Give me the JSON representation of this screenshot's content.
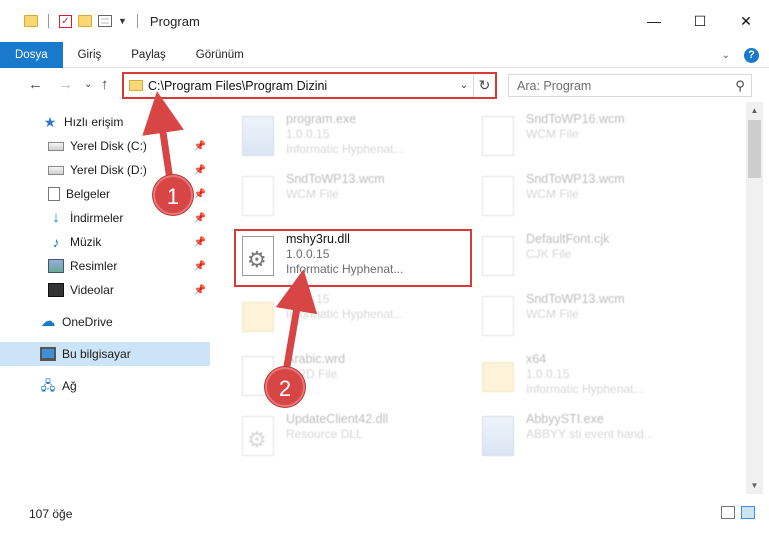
{
  "window": {
    "title": "Program",
    "minimize": "—",
    "maximize": "☐",
    "close": "✕"
  },
  "ribbon": {
    "tabs": [
      "Dosya",
      "Giriş",
      "Paylaş",
      "Görünüm"
    ],
    "active_tab": "Dosya",
    "help": "?"
  },
  "address": {
    "path": "C:\\Program Files\\Program Dizini",
    "search_placeholder": "Ara: Program"
  },
  "nav_pane": {
    "quick_access": "Hızlı erişim",
    "items": [
      {
        "label": "Yerel Disk (C:)",
        "pinned": true
      },
      {
        "label": "Yerel Disk (D:)",
        "pinned": true
      },
      {
        "label": "Belgeler",
        "pinned": true
      },
      {
        "label": "İndirmeler",
        "pinned": true
      },
      {
        "label": "Müzik",
        "pinned": true
      },
      {
        "label": "Resimler",
        "pinned": true
      },
      {
        "label": "Videolar",
        "pinned": true
      }
    ],
    "onedrive": "OneDrive",
    "this_pc": "Bu bilgisayar",
    "network": "Ağ"
  },
  "files": [
    {
      "name": "program.exe",
      "line2": "1.0.0.15",
      "line3": "Informatic Hyphenat...",
      "icon": "exe-icon"
    },
    {
      "name": "SndToWP16.wcm",
      "line2": "WCM File",
      "line3": "",
      "icon": "page-icon"
    },
    {
      "name": "SndToWP13.wcm",
      "line2": "WCM File",
      "line3": "",
      "icon": "page-icon"
    },
    {
      "name": "SndToWP13.wcm",
      "line2": "WCM File",
      "line3": "",
      "icon": "page-icon"
    },
    {
      "name": "mshy3ru.dll",
      "line2": "1.0.0.15",
      "line3": "Informatic Hyphenat...",
      "icon": "gear-file-icon"
    },
    {
      "name": "DefaultFont.cjk",
      "line2": "CJK File",
      "line3": "",
      "icon": "page-icon"
    },
    {
      "name": "",
      "line2": "1.0.0.15",
      "line3": "Informatic Hyphenat...",
      "icon": "folder-icon"
    },
    {
      "name": "SndToWP13.wcm",
      "line2": "WCM File",
      "line3": "",
      "icon": "page-icon"
    },
    {
      "name": "Arabic.wrd",
      "line2": "WRD File",
      "line3": "",
      "icon": "page-icon"
    },
    {
      "name": "x64",
      "line2": "1.0.0.15",
      "line3": "Informatic Hyphenat...",
      "icon": "folder-icon"
    },
    {
      "name": "UpdateClient42.dll",
      "line2": "Resource DLL",
      "line3": "",
      "icon": "gear-file-icon"
    },
    {
      "name": "AbbyySTI.exe",
      "line2": "ABBYY sti event hand...",
      "line3": "",
      "icon": "exe-icon"
    }
  ],
  "status": {
    "count": "107 öğe"
  },
  "annotations": {
    "step1": "1",
    "step2": "2"
  },
  "colors": {
    "accent": "#1979ca",
    "highlight_red": "#d83a3a",
    "selection": "#cce4f7"
  }
}
